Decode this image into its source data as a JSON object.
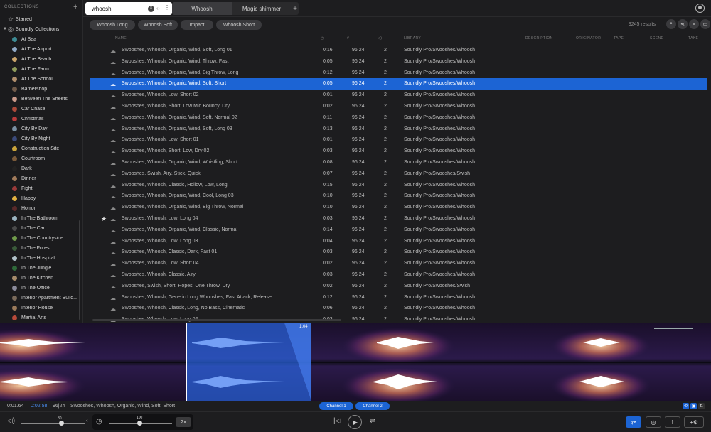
{
  "sidebar": {
    "header": "COLLECTIONS",
    "add_label": "+",
    "starred": "Starred",
    "soundly_collections": "Soundly Collections",
    "items": [
      {
        "label": "At Sea",
        "color": "#3d8a93"
      },
      {
        "label": "At The Airport",
        "color": "#8fa7c4"
      },
      {
        "label": "At The Beach",
        "color": "#c9a36a"
      },
      {
        "label": "At The Farm",
        "color": "#8e9a5a"
      },
      {
        "label": "At The School",
        "color": "#b08e6c"
      },
      {
        "label": "Barbershop",
        "color": "#6f5a4a"
      },
      {
        "label": "Between The Sheets",
        "color": "#c99a8a"
      },
      {
        "label": "Car Chase",
        "color": "#aa4a3a"
      },
      {
        "label": "Christmas",
        "color": "#b83b3b"
      },
      {
        "label": "City By Day",
        "color": "#7a8fa2"
      },
      {
        "label": "City By Night",
        "color": "#3b4a7a"
      },
      {
        "label": "Construction Site",
        "color": "#c9a33a"
      },
      {
        "label": "Courtroom",
        "color": "#7a5a3a"
      },
      {
        "label": "Dark",
        "color": "#222222"
      },
      {
        "label": "Dinner",
        "color": "#a07a5a"
      },
      {
        "label": "Fight",
        "color": "#9a3a3a"
      },
      {
        "label": "Happy",
        "color": "#e0b040"
      },
      {
        "label": "Horror",
        "color": "#5a2a2a"
      },
      {
        "label": "In The Bathroom",
        "color": "#9ab3c0"
      },
      {
        "label": "In The Car",
        "color": "#4a4a4a"
      },
      {
        "label": "In The Countryside",
        "color": "#6f9a4a"
      },
      {
        "label": "In The Forest",
        "color": "#3a5a3a"
      },
      {
        "label": "In The Hospital",
        "color": "#b0c0c8"
      },
      {
        "label": "In The Jungle",
        "color": "#2f6a3a"
      },
      {
        "label": "In The Kitchen",
        "color": "#a58a6a"
      },
      {
        "label": "In The Office",
        "color": "#8a8a9a"
      },
      {
        "label": "Interior Apartment Build...",
        "color": "#7a6a5a"
      },
      {
        "label": "Interior House",
        "color": "#9a7a5a"
      },
      {
        "label": "Martial Arts",
        "color": "#b84a3a"
      }
    ]
  },
  "search": {
    "value": "whoosh"
  },
  "tabs": [
    {
      "label": "Whoosh"
    },
    {
      "label": "Magic shimmer"
    }
  ],
  "tab_add": "+",
  "filters": {
    "chips": [
      "Whoosh Long",
      "Whoosh Soft",
      "Impact",
      "Whoosh Short"
    ],
    "results": "9245 results"
  },
  "table": {
    "headers": {
      "name": "NAME",
      "library": "LIBRARY",
      "description": "DESCRIPTION",
      "originator": "ORIGINATOR",
      "tape": "TAPE",
      "scene": "SCENE",
      "take": "TAKE"
    },
    "rows": [
      {
        "name": "Swooshes, Whoosh, Organic, Wind, Soft, Long 01",
        "duration": "0:16",
        "format": "96 24",
        "channels": "2",
        "library": "Soundly Pro/Swooshes/Whoosh"
      },
      {
        "name": "Swooshes, Whoosh, Organic, Wind, Throw, Fast",
        "duration": "0:05",
        "format": "96 24",
        "channels": "2",
        "library": "Soundly Pro/Swooshes/Whoosh"
      },
      {
        "name": "Swooshes, Whoosh, Organic, Wind, Big Throw, Long",
        "duration": "0:12",
        "format": "96 24",
        "channels": "2",
        "library": "Soundly Pro/Swooshes/Whoosh"
      },
      {
        "name": "Swooshes, Whoosh, Organic, Wind, Soft, Short",
        "duration": "0:05",
        "format": "96 24",
        "channels": "2",
        "library": "Soundly Pro/Swooshes/Whoosh"
      },
      {
        "name": "Swooshes, Whoosh, Low, Short 02",
        "duration": "0:01",
        "format": "96 24",
        "channels": "2",
        "library": "Soundly Pro/Swooshes/Whoosh"
      },
      {
        "name": "Swooshes, Whoosh, Short, Low Mid Bouncy, Dry",
        "duration": "0:02",
        "format": "96 24",
        "channels": "2",
        "library": "Soundly Pro/Swooshes/Whoosh"
      },
      {
        "name": "Swooshes, Whoosh, Organic, Wind, Soft, Normal 02",
        "duration": "0:11",
        "format": "96 24",
        "channels": "2",
        "library": "Soundly Pro/Swooshes/Whoosh"
      },
      {
        "name": "Swooshes, Whoosh, Organic, Wind, Soft, Long 03",
        "duration": "0:13",
        "format": "96 24",
        "channels": "2",
        "library": "Soundly Pro/Swooshes/Whoosh"
      },
      {
        "name": "Swooshes, Whoosh, Low, Short 01",
        "duration": "0:01",
        "format": "96 24",
        "channels": "2",
        "library": "Soundly Pro/Swooshes/Whoosh"
      },
      {
        "name": "Swooshes, Whoosh, Short, Low, Dry 02",
        "duration": "0:03",
        "format": "96 24",
        "channels": "2",
        "library": "Soundly Pro/Swooshes/Whoosh"
      },
      {
        "name": "Swooshes, Whoosh, Organic, Wind, Whistling, Short",
        "duration": "0:08",
        "format": "96 24",
        "channels": "2",
        "library": "Soundly Pro/Swooshes/Whoosh"
      },
      {
        "name": "Swooshes, Swish, Airy, Stick, Quick",
        "duration": "0:07",
        "format": "96 24",
        "channels": "2",
        "library": "Soundly Pro/Swooshes/Swish"
      },
      {
        "name": "Swooshes, Whoosh, Classic, Hollow, Low, Long",
        "duration": "0:15",
        "format": "96 24",
        "channels": "2",
        "library": "Soundly Pro/Swooshes/Whoosh"
      },
      {
        "name": "Swooshes, Whoosh, Organic, Wind, Cool, Long 03",
        "duration": "0:10",
        "format": "96 24",
        "channels": "2",
        "library": "Soundly Pro/Swooshes/Whoosh"
      },
      {
        "name": "Swooshes, Whoosh, Organic, Wind, Big Throw, Normal",
        "duration": "0:10",
        "format": "96 24",
        "channels": "2",
        "library": "Soundly Pro/Swooshes/Whoosh"
      },
      {
        "name": "Swooshes, Whoosh, Low, Long 04",
        "duration": "0:03",
        "format": "96 24",
        "channels": "2",
        "library": "Soundly Pro/Swooshes/Whoosh"
      },
      {
        "name": "Swooshes, Whoosh, Organic, Wind, Classic, Normal",
        "duration": "0:14",
        "format": "96 24",
        "channels": "2",
        "library": "Soundly Pro/Swooshes/Whoosh"
      },
      {
        "name": "Swooshes, Whoosh, Low, Long 03",
        "duration": "0:04",
        "format": "96 24",
        "channels": "2",
        "library": "Soundly Pro/Swooshes/Whoosh"
      },
      {
        "name": "Swooshes, Whoosh, Classic, Dark, Fast 01",
        "duration": "0:03",
        "format": "96 24",
        "channels": "2",
        "library": "Soundly Pro/Swooshes/Whoosh"
      },
      {
        "name": "Swooshes, Whoosh, Low, Short 04",
        "duration": "0:02",
        "format": "96 24",
        "channels": "2",
        "library": "Soundly Pro/Swooshes/Whoosh"
      },
      {
        "name": "Swooshes, Whoosh, Classic, Airy",
        "duration": "0:03",
        "format": "96 24",
        "channels": "2",
        "library": "Soundly Pro/Swooshes/Whoosh"
      },
      {
        "name": "Swooshes, Swish, Short, Ropes, One Throw, Dry",
        "duration": "0:02",
        "format": "96 24",
        "channels": "2",
        "library": "Soundly Pro/Swooshes/Swish"
      },
      {
        "name": "Swooshes, Whoosh, Generic Long Whooshes, Fast Attack, Release",
        "duration": "0:12",
        "format": "96 24",
        "channels": "2",
        "library": "Soundly Pro/Swooshes/Whoosh"
      },
      {
        "name": "Swooshes, Whoosh, Classic, Long, No Bass, Cinematic",
        "duration": "0:06",
        "format": "96 24",
        "channels": "2",
        "library": "Soundly Pro/Swooshes/Whoosh"
      },
      {
        "name": "Swooshes, Whoosh, Low, Long 02",
        "duration": "0:03",
        "format": "96 24",
        "channels": "2",
        "library": "Soundly Pro/Swooshes/Whoosh"
      }
    ]
  },
  "waveform": {
    "selection_time": "1.04"
  },
  "info": {
    "position": "0:01.64",
    "duration": "0:02.58",
    "format": "96|24",
    "filename": "Swooshes, Whoosh, Organic, Wind, Soft, Short",
    "channel1": "Channel 1",
    "channel2": "Channel 2"
  },
  "transport": {
    "volume_value": "80",
    "rate_value": "100",
    "speed": "2x"
  },
  "colors": {
    "accent": "#1c64d4"
  }
}
